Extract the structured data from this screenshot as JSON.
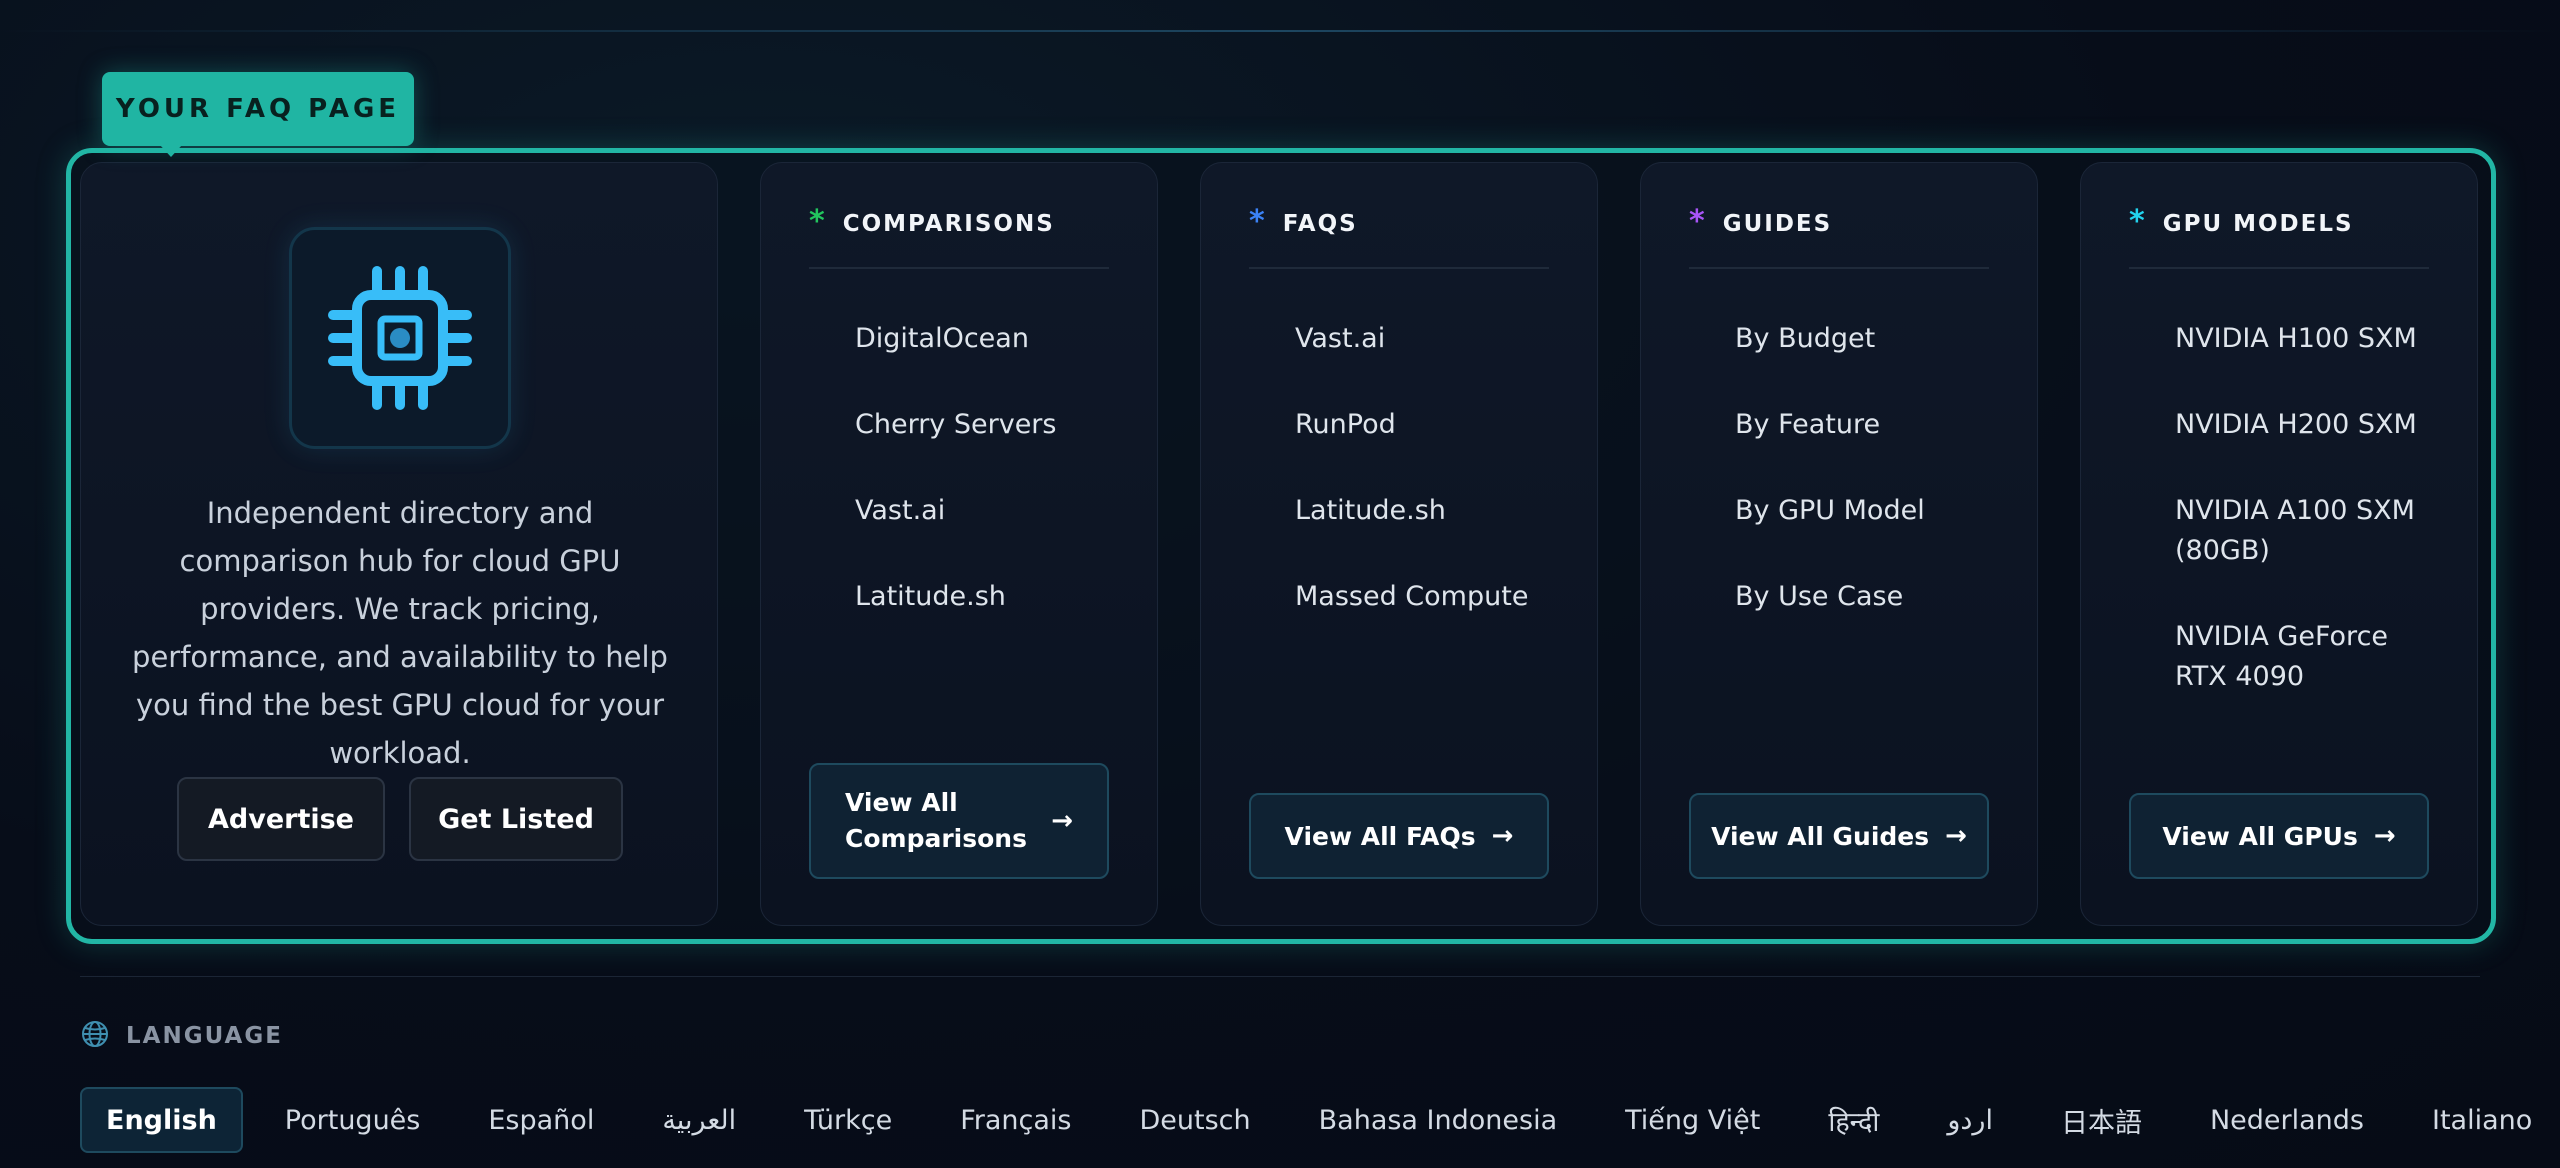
{
  "tag_label": "YOUR FAQ PAGE",
  "brand": {
    "icon": "cpu-chip-icon",
    "description": "Independent directory and comparison hub for cloud GPU providers. We track pricing, performance, and availability to help you find the best GPU cloud for your workload.",
    "advertise_label": "Advertise",
    "get_listed_label": "Get Listed"
  },
  "columns": [
    {
      "title": "COMPARISONS",
      "star": "*",
      "star_color": "#22c55e",
      "links": [
        "DigitalOcean",
        "Cherry Servers",
        "Vast.ai",
        "Latitude.sh"
      ],
      "view_all_line1": "View All",
      "view_all_line2": "Comparisons",
      "arrow": "→"
    },
    {
      "title": "FAQS",
      "star": "*",
      "star_color": "#3b82f6",
      "links": [
        "Vast.ai",
        "RunPod",
        "Latitude.sh",
        "Massed Compute"
      ],
      "view_all": "View All FAQs",
      "arrow": "→"
    },
    {
      "title": "GUIDES",
      "star": "*",
      "star_color": "#a855f7",
      "links": [
        "By Budget",
        "By Feature",
        "By GPU Model",
        "By Use Case"
      ],
      "view_all": "View All Guides",
      "arrow": "→"
    },
    {
      "title": "GPU MODELS",
      "star": "*",
      "star_color": "#22d3ee",
      "links": [
        "NVIDIA H100 SXM",
        "NVIDIA H200 SXM",
        "NVIDIA A100 SXM (80GB)",
        "NVIDIA GeForce RTX 4090"
      ],
      "view_all": "View All GPUs",
      "arrow": "→"
    }
  ],
  "language": {
    "icon": "globe-icon",
    "label": "LANGUAGE",
    "active": "English",
    "options": [
      "English",
      "Português",
      "Español",
      "العربية",
      "Türkçe",
      "Français",
      "Deutsch",
      "Bahasa Indonesia",
      "Tiếng Việt",
      "हिन्दी",
      "اردو",
      "日本語",
      "Nederlands",
      "Italiano"
    ]
  },
  "colors": {
    "accent": "#20b5a3",
    "chip": "#38bdf8"
  }
}
